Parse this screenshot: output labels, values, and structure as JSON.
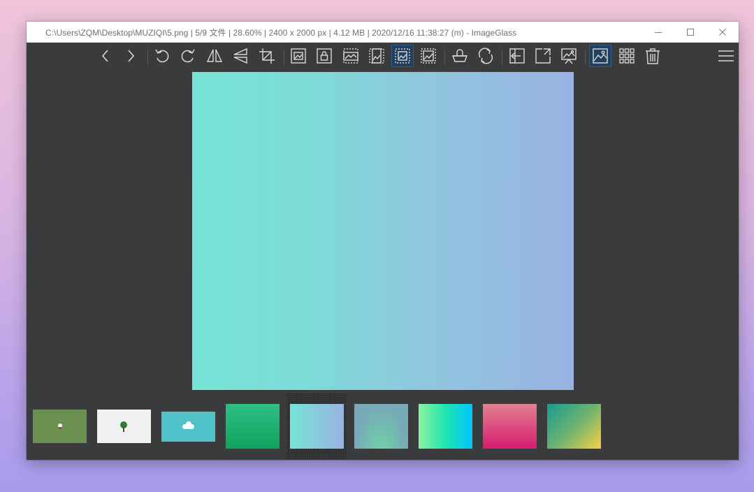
{
  "window": {
    "title": "C:\\Users\\ZQM\\Desktop\\MUZIQI\\5.png  |  5/9 文件  |  28.60%  |  2400 x 2000 px  |  4.12 MB  |  2020/12/16 11:38:27 (m)  - ImageGlass",
    "controls": [
      "minimize-icon",
      "maximize-icon",
      "close-icon"
    ]
  },
  "toolbar": {
    "icon_color": "#d9dadc",
    "active_bg": "#243f5c",
    "buttons": [
      {
        "icon": "chevron-left-icon",
        "active": false
      },
      {
        "icon": "chevron-right-icon",
        "active": false
      },
      {
        "icon": "rotate-left-icon",
        "active": false
      },
      {
        "icon": "rotate-right-icon",
        "active": false
      },
      {
        "icon": "flip-horizontal-icon",
        "active": false
      },
      {
        "icon": "flip-vertical-icon",
        "active": false
      },
      {
        "icon": "crop-icon",
        "active": false
      },
      {
        "icon": "auto-zoom-icon",
        "active": false
      },
      {
        "icon": "lock-zoom-icon",
        "active": false
      },
      {
        "icon": "scale-to-width-icon",
        "active": false
      },
      {
        "icon": "scale-to-height-icon",
        "active": false
      },
      {
        "icon": "scale-to-fit-icon",
        "active": true
      },
      {
        "icon": "scale-to-fill-icon",
        "active": false
      },
      {
        "icon": "checkerboard-icon",
        "active": false
      },
      {
        "icon": "refresh-icon",
        "active": false
      },
      {
        "icon": "open-file-icon",
        "active": false
      },
      {
        "icon": "fullscreen-icon",
        "active": false
      },
      {
        "icon": "slideshow-icon",
        "active": false
      },
      {
        "icon": "thumbnail-bar-icon",
        "active": true
      },
      {
        "icon": "grid-icon",
        "active": false
      },
      {
        "icon": "delete-icon",
        "active": false
      },
      {
        "icon": "menu-icon",
        "active": false
      }
    ]
  },
  "viewer": {
    "image_gradient": [
      "#76e4d6",
      "#99b2e2"
    ]
  },
  "thumbnails": [
    {
      "kind": "red-dot-on-green",
      "colors": [
        "#6a9152",
        "#ffffff",
        "#c0392b"
      ],
      "selected": false
    },
    {
      "kind": "tree-on-white",
      "colors": [
        "#f1f1f1",
        "#2e7d32",
        "#5d4037"
      ],
      "selected": false
    },
    {
      "kind": "cloud-on-teal",
      "colors": [
        "#4fc3c9",
        "#ffffff"
      ],
      "selected": false
    },
    {
      "kind": "gradient",
      "colors": [
        "#2fbf86",
        "#0ea35d"
      ],
      "selected": false
    },
    {
      "kind": "gradient",
      "colors": [
        "#76e4d6",
        "#99b2e2"
      ],
      "selected": true
    },
    {
      "kind": "gradient",
      "colors": [
        "#78a9b8",
        "#6ed4a6"
      ],
      "selected": false
    },
    {
      "kind": "gradient",
      "colors": [
        "#8cf5a0",
        "#20e3b2",
        "#00c6ff"
      ],
      "selected": false
    },
    {
      "kind": "gradient",
      "colors": [
        "#e0828f",
        "#d61b71"
      ],
      "selected": false
    },
    {
      "kind": "gradient",
      "colors": [
        "#179c8f",
        "#f7d142"
      ],
      "selected": false
    }
  ]
}
